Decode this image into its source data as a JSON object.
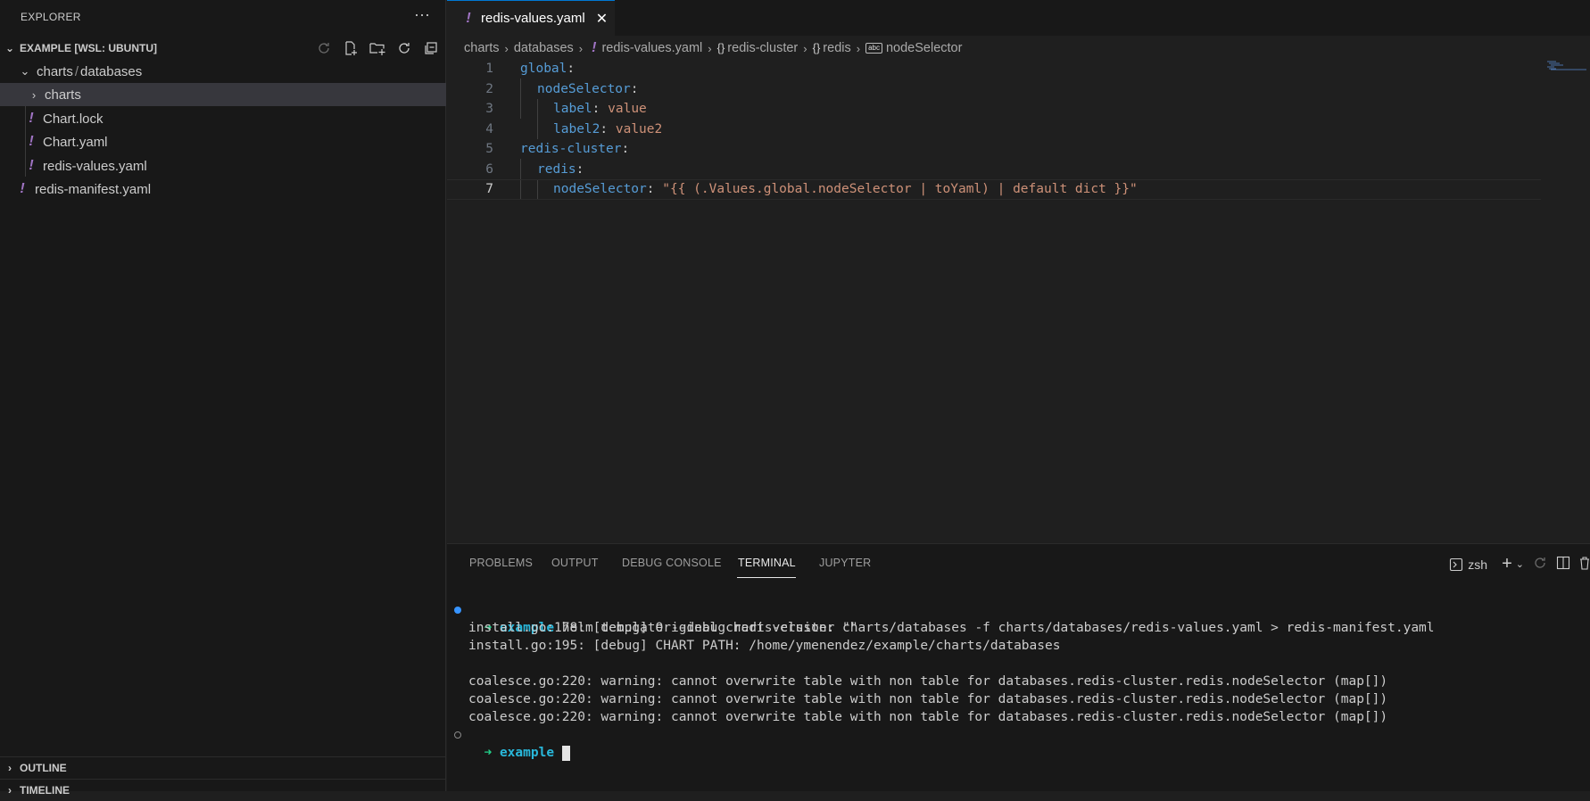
{
  "sidebar": {
    "title": "EXPLORER",
    "more_icon": "ellipsis-icon",
    "workspace": "EXAMPLE [WSL: UBUNTU]",
    "tree": {
      "folder_path": "charts",
      "folder_path_sep": "/",
      "folder_path_2": "databases",
      "items": [
        {
          "label": "charts",
          "kind": "folder"
        },
        {
          "label": "Chart.lock",
          "kind": "yaml"
        },
        {
          "label": "Chart.yaml",
          "kind": "yaml"
        },
        {
          "label": "redis-values.yaml",
          "kind": "yaml"
        },
        {
          "label": "redis-manifest.yaml",
          "kind": "yaml"
        }
      ]
    },
    "outline": "OUTLINE",
    "timeline": "TIMELINE"
  },
  "editor": {
    "tab": {
      "label": "redis-values.yaml",
      "close": "✕"
    },
    "breadcrumb": [
      {
        "label": "charts"
      },
      {
        "label": "databases"
      },
      {
        "label": "redis-values.yaml",
        "icon": "!"
      },
      {
        "label": "redis-cluster",
        "icon": "{}"
      },
      {
        "label": "redis",
        "icon": "{}"
      },
      {
        "label": "nodeSelector",
        "icon": "abc"
      }
    ],
    "line_numbers": [
      "1",
      "2",
      "3",
      "4",
      "5",
      "6",
      "7"
    ],
    "lines": [
      {
        "key": "global",
        "colon": ":",
        "value": ""
      },
      {
        "key": "nodeSelector",
        "colon": ":",
        "value": ""
      },
      {
        "key": "label",
        "colon": ": ",
        "value": "value"
      },
      {
        "key": "label2",
        "colon": ": ",
        "value": "value2"
      },
      {
        "key": "redis-cluster",
        "colon": ":",
        "value": ""
      },
      {
        "key": "redis",
        "colon": ":",
        "value": ""
      },
      {
        "key": "nodeSelector",
        "colon": ": ",
        "value": "\"{{ (.Values.global.nodeSelector | toYaml) | default dict }}\""
      }
    ]
  },
  "panel": {
    "tabs": [
      "PROBLEMS",
      "OUTPUT",
      "DEBUG CONSOLE",
      "TERMINAL",
      "JUPYTER"
    ],
    "active_tab": "TERMINAL",
    "shell": "zsh",
    "terminal": {
      "prompt_arrow": "➜",
      "prompt_dir": "example",
      "command": "helm template --debug redis-cluster charts/databases -f charts/databases/redis-values.yaml > redis-manifest.yaml",
      "output": [
        "install.go:178: [debug] Original chart version: \"\"",
        "install.go:195: [debug] CHART PATH: /home/ymenendez/example/charts/databases",
        "",
        "coalesce.go:220: warning: cannot overwrite table with non table for databases.redis-cluster.redis.nodeSelector (map[])",
        "coalesce.go:220: warning: cannot overwrite table with non table for databases.redis-cluster.redis.nodeSelector (map[])",
        "coalesce.go:220: warning: cannot overwrite table with non table for databases.redis-cluster.redis.nodeSelector (map[])"
      ]
    }
  },
  "colors": {
    "yaml_icon": "#a074c4",
    "key": "#569cd6",
    "string": "#ce9178",
    "accent": "#0078d4",
    "prompt_arrow": "#23d18b",
    "prompt_dir": "#29b8db"
  }
}
